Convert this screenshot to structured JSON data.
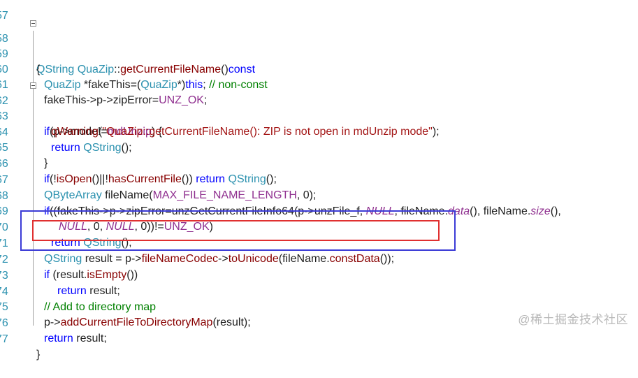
{
  "editor": {
    "lines": [
      {
        "num": "57",
        "code": ""
      },
      {
        "num": "58",
        "code": "QString QuaZip::getCurrentFileName()const"
      },
      {
        "num": "59",
        "code": "{"
      },
      {
        "num": "60",
        "code": "QuaZip *fakeThis=(QuaZip*)this; // non-const"
      },
      {
        "num": "61",
        "code": "fakeThis->p->zipError=UNZ_OK;"
      },
      {
        "num": "62",
        "code": "if(p->mode!=mdUnzip) {"
      },
      {
        "num": "63",
        "code": "qWarning(\"QuaZip::getCurrentFileName(): ZIP is not open in mdUnzip mode\");"
      },
      {
        "num": "64",
        "code": "return QString();"
      },
      {
        "num": "65",
        "code": "}"
      },
      {
        "num": "66",
        "code": "if(!isOpen()||!hasCurrentFile()) return QString();"
      },
      {
        "num": "67",
        "code": "QByteArray fileName(MAX_FILE_NAME_LENGTH, 0);"
      },
      {
        "num": "68",
        "code": "if((fakeThis->p->zipError=unzGetCurrentFileInfo64(p->unzFile_f, NULL, fileName.data(), fileName.size(),"
      },
      {
        "num": "69",
        "code": "NULL, 0, NULL, 0))!=UNZ_OK)"
      },
      {
        "num": "70",
        "code": "return QString();"
      },
      {
        "num": "71",
        "code": "QString result = p->fileNameCodec->toUnicode(fileName.constData());"
      },
      {
        "num": "72",
        "code": "if (result.isEmpty())"
      },
      {
        "num": "73",
        "code": "return result;"
      },
      {
        "num": "74",
        "code": "// Add to directory map"
      },
      {
        "num": "75",
        "code": "p->addCurrentFileToDirectoryMap(result);"
      },
      {
        "num": "76",
        "code": "return result;"
      },
      {
        "num": "77",
        "code": "}"
      }
    ]
  },
  "watermark": "@稀土掘金技术社区",
  "colors": {
    "highlight_blue": "#3b3bd6",
    "highlight_red": "#e03030",
    "line_number": "#2b91af"
  }
}
